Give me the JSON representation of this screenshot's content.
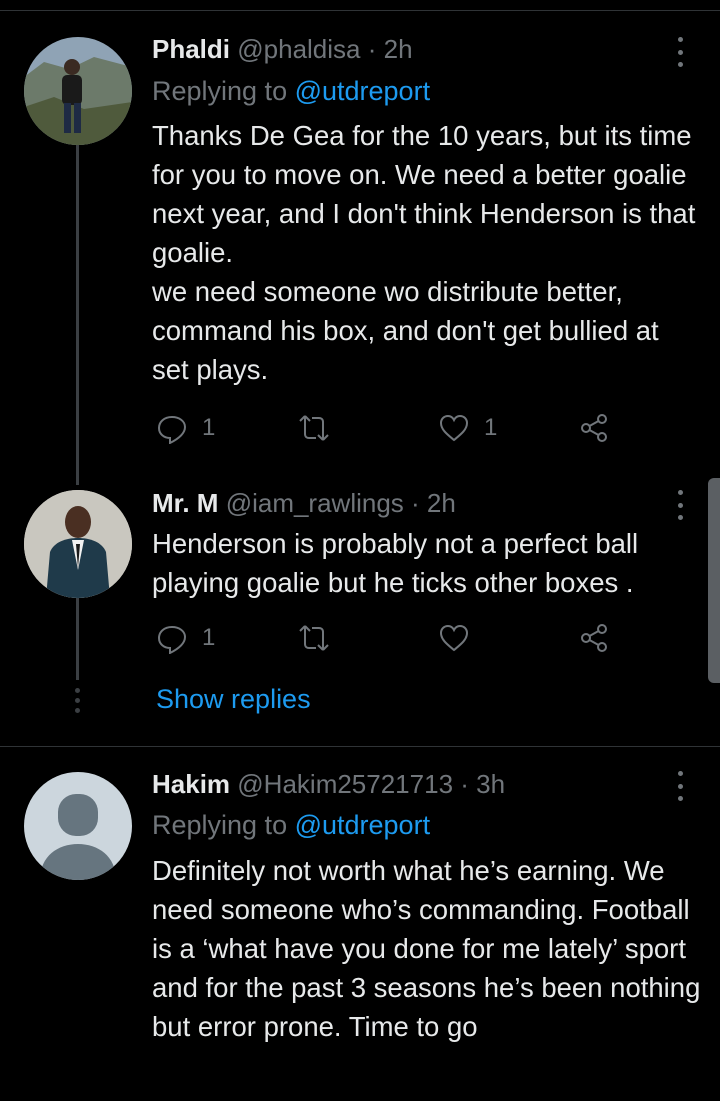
{
  "tweets": [
    {
      "name": "Phaldi",
      "handle": "@phaldisa",
      "time": "· 2h",
      "replying_prefix": "Replying to ",
      "replying_handle": "@utdreport",
      "text": "Thanks De Gea for the 10 years, but its time for you to move on. We need a better goalie next year, and I don't think Henderson is that goalie.\nwe need someone wo distribute better, command his box, and don't get bullied at set plays.",
      "replies": "1",
      "likes": "1"
    },
    {
      "name": "Mr. M",
      "handle": "@iam_rawlings",
      "time": "· 2h",
      "text": "Henderson is probably not a perfect ball playing goalie but he ticks other boxes .",
      "replies": "1"
    },
    {
      "name": "Hakim",
      "handle": "@Hakim25721713",
      "time": "· 3h",
      "replying_prefix": "Replying to ",
      "replying_handle": "@utdreport",
      "text": "Definitely not worth what he’s earning. We need someone who’s commanding. Football is a ‘what have you done for me lately’ sport and for the past 3 seasons he’s been nothing but error prone. Time to go"
    }
  ],
  "show_replies": "Show replies",
  "colors": {
    "background": "#000000",
    "text": "#e7e9ea",
    "secondary": "#71767b",
    "link": "#1d9bf0"
  },
  "icons": [
    "reply-icon",
    "retweet-icon",
    "like-icon",
    "share-icon",
    "more-options-icon",
    "default-avatar-icon"
  ]
}
